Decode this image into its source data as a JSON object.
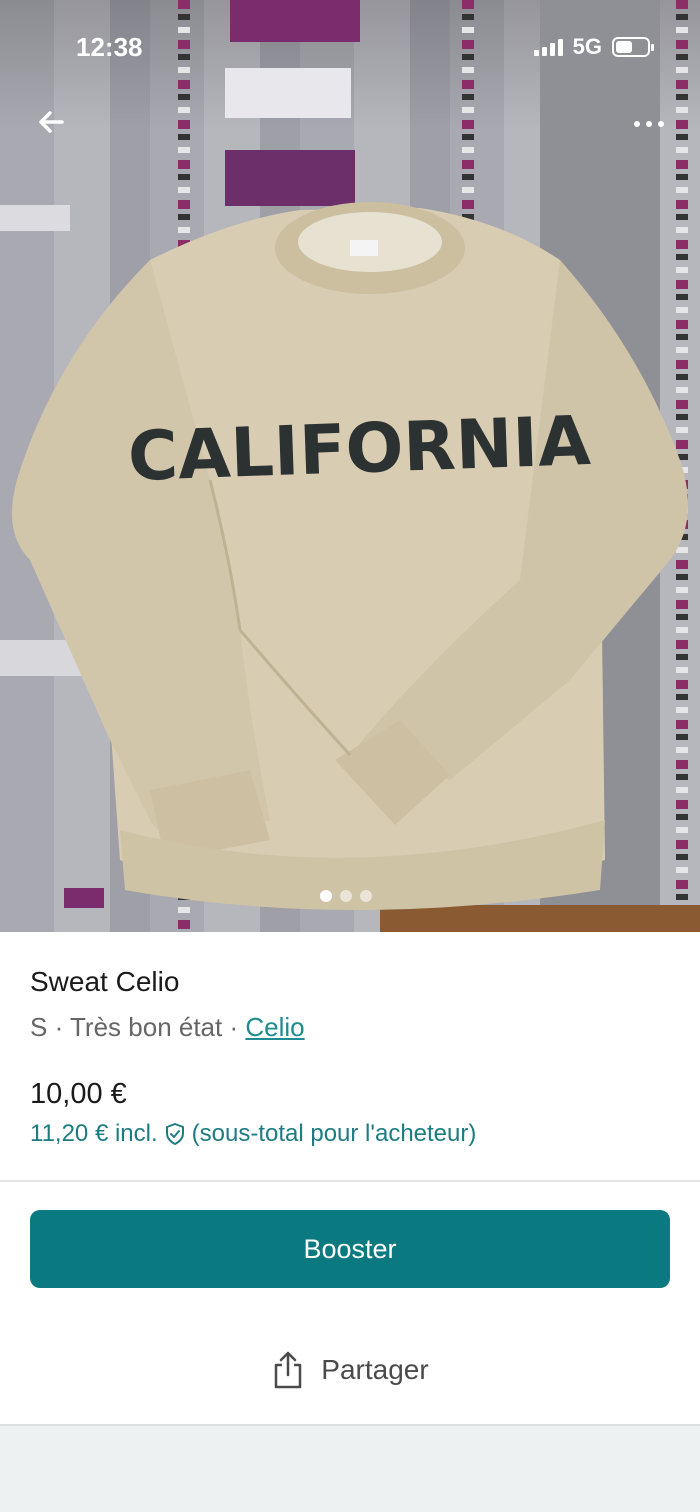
{
  "status_bar": {
    "time": "12:38",
    "network": "5G"
  },
  "nav": {
    "back_icon": "arrow-left-icon",
    "more_icon": "more-horizontal-icon"
  },
  "photo": {
    "print_text": "CALIFORNIA",
    "page_count": 3,
    "active_page": 1
  },
  "listing": {
    "title": "Sweat Celio",
    "size": "S",
    "condition": "Très bon état",
    "separator": "·",
    "brand": "Celio",
    "price": "10,00 €",
    "buyer_price": "11,20 € incl.",
    "buyer_note": "(sous-total pour l'acheteur)",
    "shield_icon": "shield-check-icon"
  },
  "actions": {
    "boost_label": "Booster",
    "share_label": "Partager",
    "share_icon": "share-icon"
  },
  "colors": {
    "accent": "#0b7a80",
    "link": "#1f8a8f"
  }
}
